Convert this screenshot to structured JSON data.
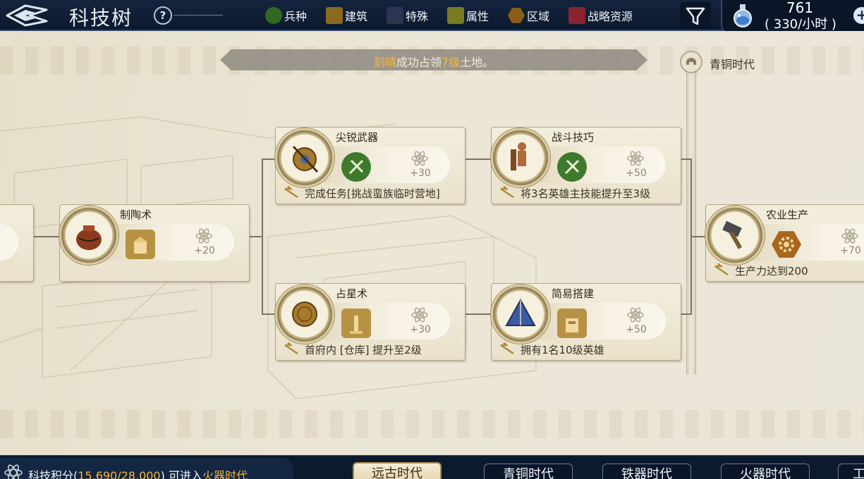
{
  "topbar": {
    "title": "科技树",
    "help_label": "?",
    "legend": [
      {
        "label": "兵种",
        "color": "#2f6a20",
        "shape": "circle"
      },
      {
        "label": "建筑",
        "color": "#8b6a1e",
        "shape": "rect"
      },
      {
        "label": "特殊",
        "color": "#2a3552",
        "shape": "rect"
      },
      {
        "label": "属性",
        "color": "#7a7a24",
        "shape": "rect"
      },
      {
        "label": "区域",
        "color": "#8a5e16",
        "shape": "hex"
      },
      {
        "label": "战略资源",
        "color": "#8a2330",
        "shape": "rect"
      }
    ],
    "filter_icon": "funnel-icon",
    "resource": {
      "icon": "flask-icon",
      "value": "761",
      "rate": "( 330/小时 )",
      "add_label": "+"
    }
  },
  "notice": {
    "name": "刻晴",
    "text_mid": "成功占领",
    "level": "7级",
    "text_end": "土地。"
  },
  "era_marker": {
    "label": "青铜时代",
    "icon": "helmet-icon"
  },
  "techs": [
    {
      "id": "pottery",
      "name": "制陶术",
      "points": "+20",
      "requirement": "",
      "medallion_icon": "pot-icon",
      "unlock_icon": "building-icon",
      "unlock_color": "#b89244"
    },
    {
      "id": "sharp-weapons",
      "name": "尖锐武器",
      "points": "+30",
      "requirement": "完成任务[挑战蛮族临时营地]",
      "medallion_icon": "shield-spear-icon",
      "unlock_icon": "unit-icon",
      "unlock_color": "#3f7a2c"
    },
    {
      "id": "combat-skill",
      "name": "战斗技巧",
      "points": "+50",
      "requirement": "将3名英雄主技能提升至3级",
      "medallion_icon": "warrior-icon",
      "unlock_icon": "unit-icon",
      "unlock_color": "#3f7a2c"
    },
    {
      "id": "astrology",
      "name": "占星术",
      "points": "+30",
      "requirement": "首府内 [仓库] 提升至2级",
      "medallion_icon": "astrolabe-icon",
      "unlock_icon": "building-icon",
      "unlock_color": "#b89244"
    },
    {
      "id": "simple-build",
      "name": "简易搭建",
      "points": "+50",
      "requirement": "拥有1名10级英雄",
      "medallion_icon": "tent-icon",
      "unlock_icon": "building-icon",
      "unlock_color": "#b89244"
    },
    {
      "id": "agriculture",
      "name": "农业生产",
      "points": "+70",
      "requirement": "生产力达到200",
      "medallion_icon": "hammer-icon",
      "unlock_icon": "gear-icon",
      "unlock_color": "#a8661e"
    }
  ],
  "bottombar": {
    "score_label": "科技积分(",
    "score_value": "15,690/28,000",
    "score_mid": ")  可进入",
    "score_era": "火器时代",
    "tabs": [
      {
        "label": "远古时代",
        "active": true
      },
      {
        "label": "青铜时代",
        "active": false
      },
      {
        "label": "铁器时代",
        "active": false
      },
      {
        "label": "火器时代",
        "active": false
      },
      {
        "label": "工",
        "active": false
      }
    ]
  }
}
